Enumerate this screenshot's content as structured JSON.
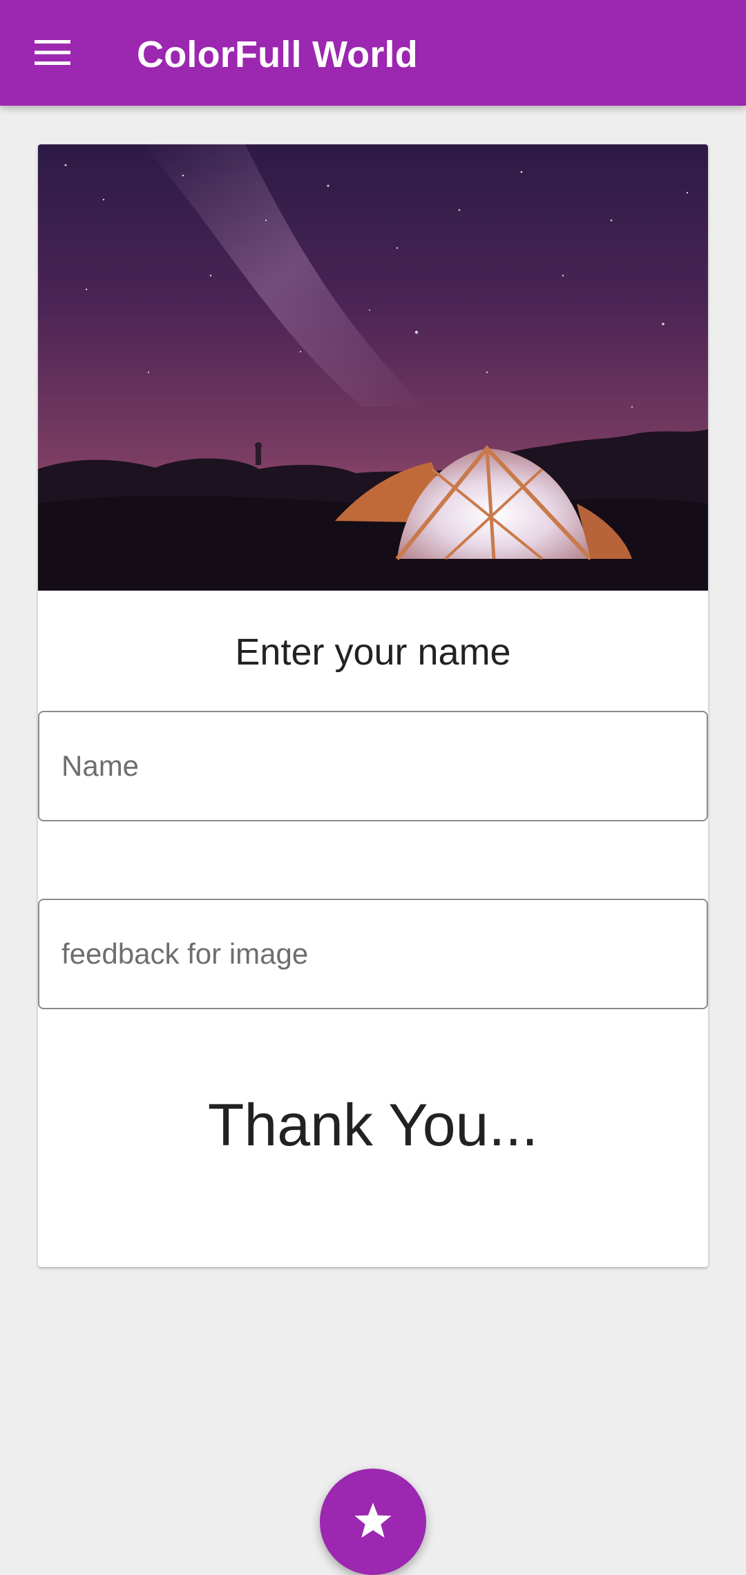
{
  "appbar": {
    "title": "ColorFull World",
    "menu_icon": "menu-icon",
    "color": "#9c27b0"
  },
  "card": {
    "image_alt": "Night sky with milky way over a glowing tent",
    "prompt": "Enter your name",
    "name_field": {
      "value": "",
      "placeholder": "Name"
    },
    "feedback_field": {
      "value": "",
      "placeholder": "feedback for image"
    },
    "thanks": "Thank You..."
  },
  "fab": {
    "icon": "star-icon",
    "color": "#9c27b0"
  }
}
